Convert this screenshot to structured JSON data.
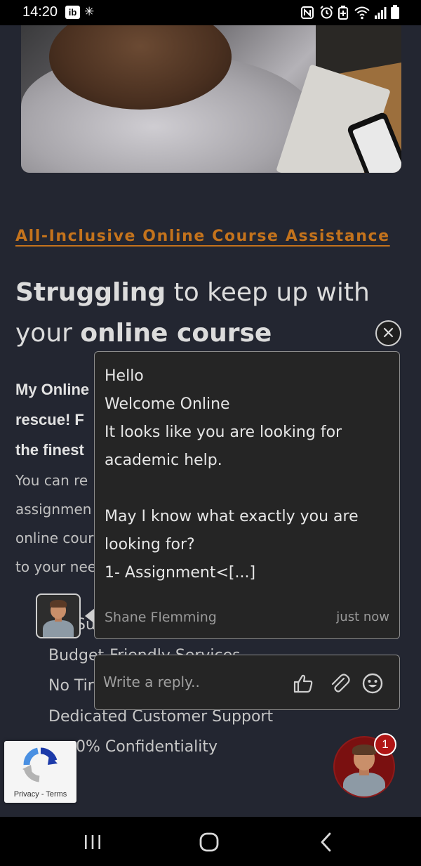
{
  "status_bar": {
    "time": "14:20",
    "left_icons": [
      "ib-app-icon",
      "sparkle-icon"
    ],
    "right_icons": [
      "nfc-icon",
      "alarm-icon",
      "battery-saver-icon",
      "wifi-icon",
      "signal-icon",
      "battery-icon"
    ],
    "ib_label": "ib"
  },
  "hero": {
    "image": "student-with-notebook-photo"
  },
  "section": {
    "kicker": "All-Inclusive Online Course Assistance",
    "headline_bold_1": "Struggling",
    "headline_rest_1": " to keep up with",
    "headline_plain_2": "your ",
    "headline_bold_2": "online course",
    "bold_lines": [
      "My Online",
      "rescue! F",
      "the finest"
    ],
    "para_lines": [
      "You can re",
      "assignmen",
      "online cour",
      "to your nee"
    ]
  },
  "features": [
    "Su",
    "Budget-Friendly Services",
    "No Tir",
    "Dedicated Customer Support",
    "0% Confidentiality"
  ],
  "chat": {
    "message": "Hello\nWelcome Online\nIt looks like you are looking for\nacademic help.\n\nMay I know what exactly you are\nlooking for?\n1- Assignment<[...]",
    "sender": "Shane Flemming",
    "time": "just now",
    "reply_placeholder": "Write a reply..",
    "close_symbol": "×"
  },
  "launcher": {
    "badge_count": "1"
  },
  "recaptcha": {
    "links": "Privacy - Terms"
  },
  "colors": {
    "accent": "#c4731c",
    "background": "#232631",
    "badge": "#b01515"
  }
}
